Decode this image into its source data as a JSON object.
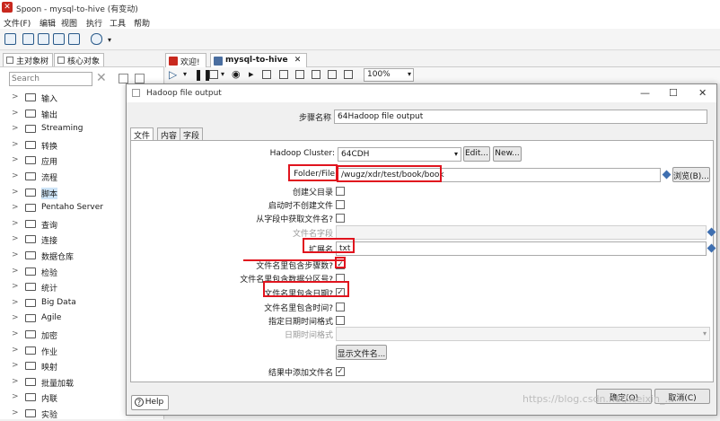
{
  "window": {
    "title": "Spoon - mysql-to-hive (有变动)"
  },
  "menu": [
    "文件(F)",
    "编辑",
    "视图",
    "执行",
    "工具",
    "帮助"
  ],
  "left_tabs": {
    "main_objects": "主对象树",
    "core_objects": "核心对象"
  },
  "search": {
    "placeholder": "Search"
  },
  "tree_items": [
    "输入",
    "输出",
    "Streaming",
    "转换",
    "应用",
    "流程",
    "脚本",
    "Pentaho Server",
    "查询",
    "连接",
    "数据仓库",
    "检验",
    "统计",
    "Big Data",
    "Agile",
    "加密",
    "作业",
    "映射",
    "批量加载",
    "内联",
    "实验"
  ],
  "selected_tree_item": "脚本",
  "editor_tabs": {
    "welcome": "欢迎!",
    "transform": "mysql-to-hive"
  },
  "zoom": "100%",
  "dialog": {
    "title": "Hadoop file output",
    "step_name_label": "步骤名称",
    "step_name_value": "64Hadoop file output",
    "tabs": [
      "文件",
      "内容",
      "字段"
    ],
    "hadoop_cluster_label": "Hadoop Cluster:",
    "hadoop_cluster_value": "64CDH",
    "edit_button": "Edit...",
    "new_button": "New...",
    "folder_file_label": "Folder/File",
    "folder_file_value": "/wugz/xdr/test/book/book",
    "browse_button": "浏览(B)...",
    "create_parent_label": "创建父目录",
    "create_parent_checked": false,
    "no_create_on_start_label": "启动时不创建文件",
    "no_create_on_start_checked": false,
    "filename_from_field_label": "从字段中获取文件名?",
    "filename_from_field_checked": false,
    "filename_field_label": "文件名字段",
    "extension_label": "扩展名",
    "extension_value": "txt",
    "include_step_nr_label": "文件名里包含步骤数?",
    "include_step_nr_checked": true,
    "include_partition_label": "文件名里包含数据分区号?",
    "include_partition_checked": false,
    "include_date_label": "文件名里包含日期?",
    "include_date_checked": true,
    "include_time_label": "文件名里包含时间?",
    "include_time_checked": false,
    "specify_date_format_label": "指定日期时间格式",
    "specify_date_format_checked": false,
    "date_format_label": "日期时间格式",
    "show_filenames_button": "显示文件名...",
    "add_to_result_label": "结果中添加文件名",
    "add_to_result_checked": true,
    "help_button": "Help",
    "ok_button": "确定(O)",
    "cancel_button": "取消(C)"
  },
  "watermark": "https://blog.csdn.net/weixin_..."
}
